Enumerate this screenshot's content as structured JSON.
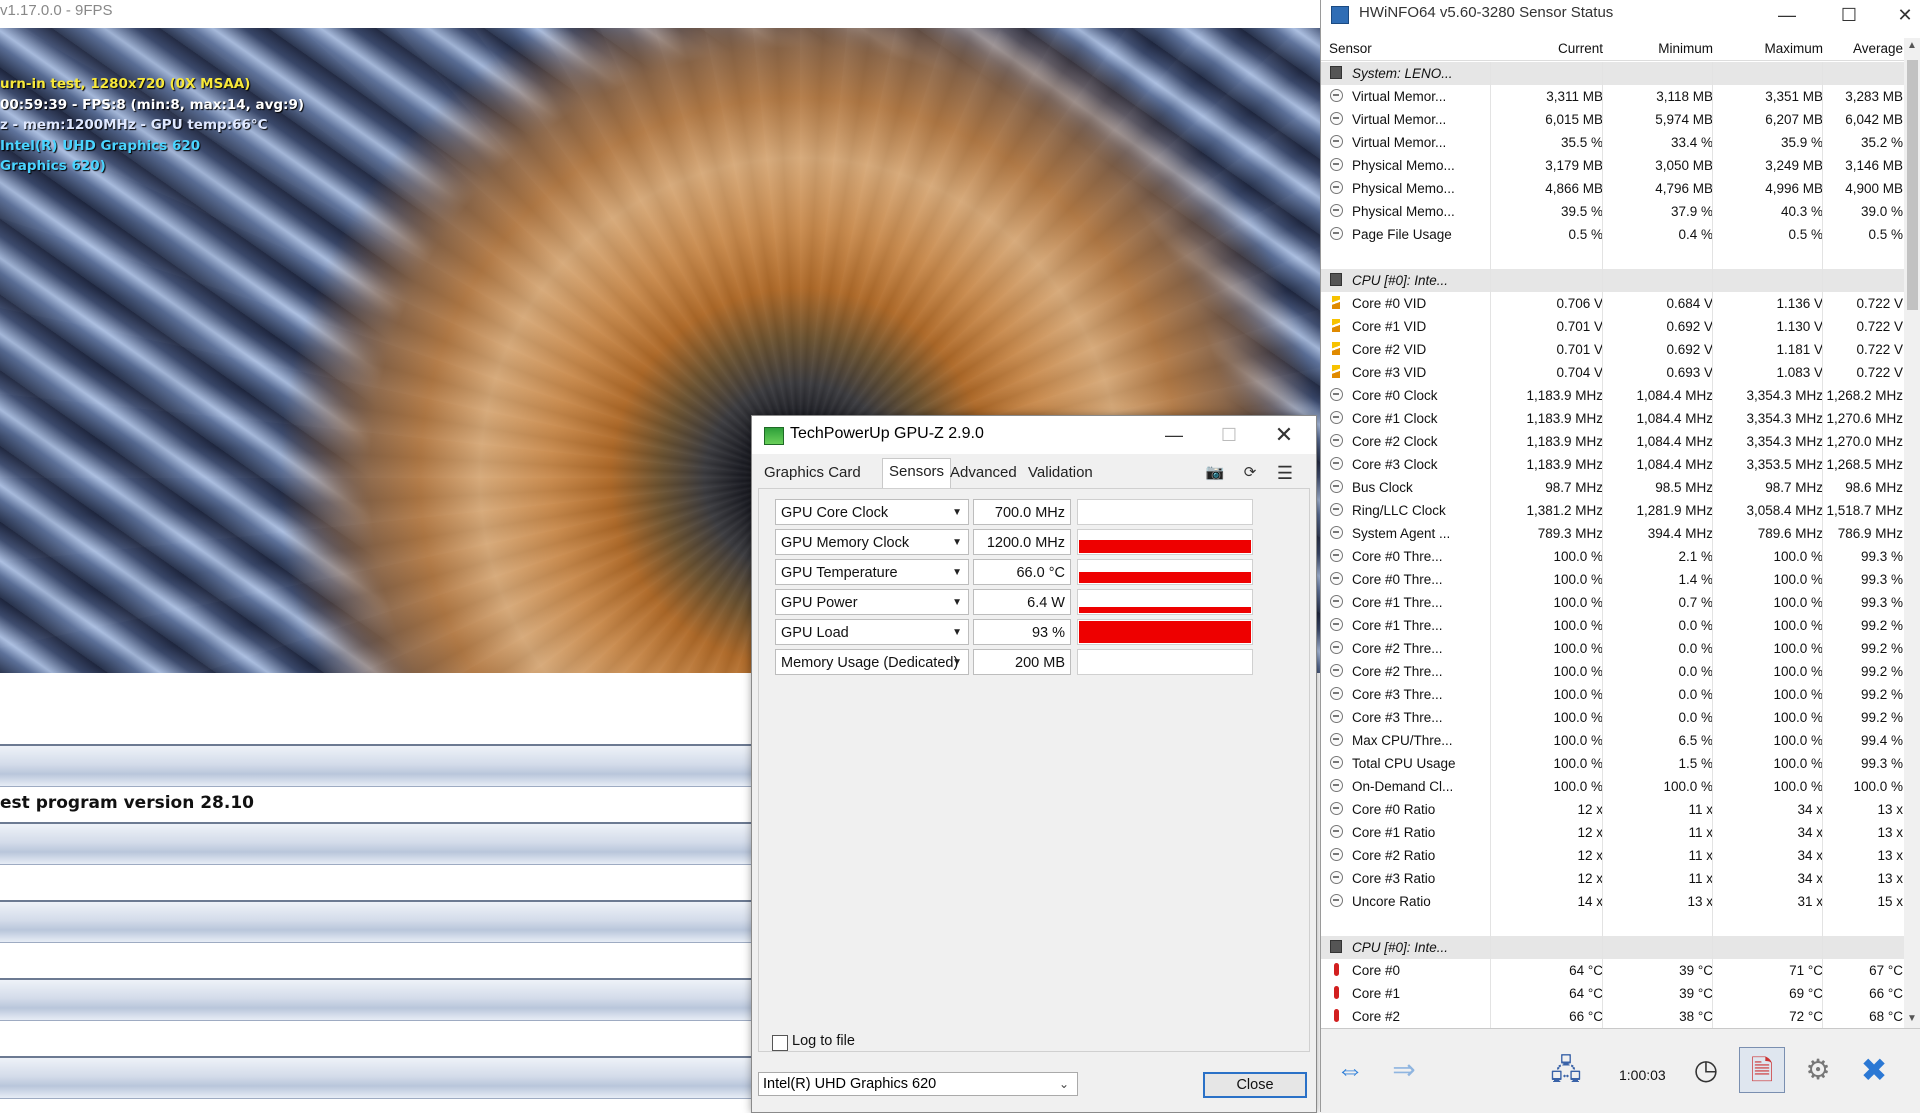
{
  "furmark": {
    "title": "v1.17.0.0 - 9FPS",
    "osd": [
      "urn-in test, 1280x720 (0X MSAA)",
      "00:59:39 - FPS:8 (min:8, max:14, avg:9)",
      "z - mem:1200MHz - GPU temp:66°C",
      "Intel(R) UHD Graphics 620",
      "Graphics 620)"
    ],
    "version_text": "est program version 28.10"
  },
  "gpuz": {
    "title": "TechPowerUp GPU-Z 2.9.0",
    "tabs": [
      "Graphics Card",
      "Sensors",
      "Advanced",
      "Validation"
    ],
    "active_tab": "Sensors",
    "sensors": [
      {
        "name": "GPU Core Clock",
        "value": "700.0 MHz",
        "graph_level": 0
      },
      {
        "name": "GPU Memory Clock",
        "value": "1200.0 MHz",
        "graph_level": 0.55
      },
      {
        "name": "GPU Temperature",
        "value": "66.0 °C",
        "graph_level": 0.45
      },
      {
        "name": "GPU Power",
        "value": "6.4 W",
        "graph_level": 0.25
      },
      {
        "name": "GPU Load",
        "value": "93 %",
        "graph_level": 0.93
      },
      {
        "name": "Memory Usage (Dedicated)",
        "value": "200 MB",
        "graph_level": 0
      }
    ],
    "log_label": "Log to file",
    "gpu_select": "Intel(R) UHD Graphics 620",
    "close_label": "Close",
    "graph_color": "#ee0000"
  },
  "hwinfo": {
    "title": "HWiNFO64 v5.60-3280 Sensor Status",
    "columns": [
      "Sensor",
      "Current",
      "Minimum",
      "Maximum",
      "Average"
    ],
    "rows": [
      {
        "type": "group",
        "icon": "chip",
        "name": "System: LENO..."
      },
      {
        "icon": "clock",
        "name": "Virtual Memor...",
        "cur": "3,311 MB",
        "min": "3,118 MB",
        "max": "3,351 MB",
        "avg": "3,283 MB"
      },
      {
        "icon": "clock",
        "name": "Virtual Memor...",
        "cur": "6,015 MB",
        "min": "5,974 MB",
        "max": "6,207 MB",
        "avg": "6,042 MB"
      },
      {
        "icon": "clock",
        "name": "Virtual Memor...",
        "cur": "35.5 %",
        "min": "33.4 %",
        "max": "35.9 %",
        "avg": "35.2 %"
      },
      {
        "icon": "clock",
        "name": "Physical Memo...",
        "cur": "3,179 MB",
        "min": "3,050 MB",
        "max": "3,249 MB",
        "avg": "3,146 MB"
      },
      {
        "icon": "clock",
        "name": "Physical Memo...",
        "cur": "4,866 MB",
        "min": "4,796 MB",
        "max": "4,996 MB",
        "avg": "4,900 MB"
      },
      {
        "icon": "clock",
        "name": "Physical Memo...",
        "cur": "39.5 %",
        "min": "37.9 %",
        "max": "40.3 %",
        "avg": "39.0 %"
      },
      {
        "icon": "clock",
        "name": "Page File Usage",
        "cur": "0.5 %",
        "min": "0.4 %",
        "max": "0.5 %",
        "avg": "0.5 %"
      },
      {
        "type": "blank"
      },
      {
        "type": "group",
        "icon": "chip",
        "name": "CPU [#0]: Inte..."
      },
      {
        "icon": "volt",
        "name": "Core #0 VID",
        "cur": "0.706 V",
        "min": "0.684 V",
        "max": "1.136 V",
        "avg": "0.722 V"
      },
      {
        "icon": "volt",
        "name": "Core #1 VID",
        "cur": "0.701 V",
        "min": "0.692 V",
        "max": "1.130 V",
        "avg": "0.722 V"
      },
      {
        "icon": "volt",
        "name": "Core #2 VID",
        "cur": "0.701 V",
        "min": "0.692 V",
        "max": "1.181 V",
        "avg": "0.722 V"
      },
      {
        "icon": "volt",
        "name": "Core #3 VID",
        "cur": "0.704 V",
        "min": "0.693 V",
        "max": "1.083 V",
        "avg": "0.722 V"
      },
      {
        "icon": "clock",
        "name": "Core #0 Clock",
        "cur": "1,183.9 MHz",
        "min": "1,084.4 MHz",
        "max": "3,354.3 MHz",
        "avg": "1,268.2 MHz"
      },
      {
        "icon": "clock",
        "name": "Core #1 Clock",
        "cur": "1,183.9 MHz",
        "min": "1,084.4 MHz",
        "max": "3,354.3 MHz",
        "avg": "1,270.6 MHz"
      },
      {
        "icon": "clock",
        "name": "Core #2 Clock",
        "cur": "1,183.9 MHz",
        "min": "1,084.4 MHz",
        "max": "3,354.3 MHz",
        "avg": "1,270.0 MHz"
      },
      {
        "icon": "clock",
        "name": "Core #3 Clock",
        "cur": "1,183.9 MHz",
        "min": "1,084.4 MHz",
        "max": "3,353.5 MHz",
        "avg": "1,268.5 MHz"
      },
      {
        "icon": "clock",
        "name": "Bus Clock",
        "cur": "98.7 MHz",
        "min": "98.5 MHz",
        "max": "98.7 MHz",
        "avg": "98.6 MHz"
      },
      {
        "icon": "clock",
        "name": "Ring/LLC Clock",
        "cur": "1,381.2 MHz",
        "min": "1,281.9 MHz",
        "max": "3,058.4 MHz",
        "avg": "1,518.7 MHz"
      },
      {
        "icon": "clock",
        "name": "System Agent ...",
        "cur": "789.3 MHz",
        "min": "394.4 MHz",
        "max": "789.6 MHz",
        "avg": "786.9 MHz"
      },
      {
        "icon": "clock",
        "name": "Core #0 Thre...",
        "cur": "100.0 %",
        "min": "2.1 %",
        "max": "100.0 %",
        "avg": "99.3 %"
      },
      {
        "icon": "clock",
        "name": "Core #0 Thre...",
        "cur": "100.0 %",
        "min": "1.4 %",
        "max": "100.0 %",
        "avg": "99.3 %"
      },
      {
        "icon": "clock",
        "name": "Core #1 Thre...",
        "cur": "100.0 %",
        "min": "0.7 %",
        "max": "100.0 %",
        "avg": "99.3 %"
      },
      {
        "icon": "clock",
        "name": "Core #1 Thre...",
        "cur": "100.0 %",
        "min": "0.0 %",
        "max": "100.0 %",
        "avg": "99.2 %"
      },
      {
        "icon": "clock",
        "name": "Core #2 Thre...",
        "cur": "100.0 %",
        "min": "0.0 %",
        "max": "100.0 %",
        "avg": "99.2 %"
      },
      {
        "icon": "clock",
        "name": "Core #2 Thre...",
        "cur": "100.0 %",
        "min": "0.0 %",
        "max": "100.0 %",
        "avg": "99.2 %"
      },
      {
        "icon": "clock",
        "name": "Core #3 Thre...",
        "cur": "100.0 %",
        "min": "0.0 %",
        "max": "100.0 %",
        "avg": "99.2 %"
      },
      {
        "icon": "clock",
        "name": "Core #3 Thre...",
        "cur": "100.0 %",
        "min": "0.0 %",
        "max": "100.0 %",
        "avg": "99.2 %"
      },
      {
        "icon": "clock",
        "name": "Max CPU/Thre...",
        "cur": "100.0 %",
        "min": "6.5 %",
        "max": "100.0 %",
        "avg": "99.4 %"
      },
      {
        "icon": "clock",
        "name": "Total CPU Usage",
        "cur": "100.0 %",
        "min": "1.5 %",
        "max": "100.0 %",
        "avg": "99.3 %"
      },
      {
        "icon": "clock",
        "name": "On-Demand Cl...",
        "cur": "100.0 %",
        "min": "100.0 %",
        "max": "100.0 %",
        "avg": "100.0 %"
      },
      {
        "icon": "clock",
        "name": "Core #0 Ratio",
        "cur": "12 x",
        "min": "11 x",
        "max": "34 x",
        "avg": "13 x"
      },
      {
        "icon": "clock",
        "name": "Core #1 Ratio",
        "cur": "12 x",
        "min": "11 x",
        "max": "34 x",
        "avg": "13 x"
      },
      {
        "icon": "clock",
        "name": "Core #2 Ratio",
        "cur": "12 x",
        "min": "11 x",
        "max": "34 x",
        "avg": "13 x"
      },
      {
        "icon": "clock",
        "name": "Core #3 Ratio",
        "cur": "12 x",
        "min": "11 x",
        "max": "34 x",
        "avg": "13 x"
      },
      {
        "icon": "clock",
        "name": "Uncore Ratio",
        "cur": "14 x",
        "min": "13 x",
        "max": "31 x",
        "avg": "15 x"
      },
      {
        "type": "blank"
      },
      {
        "type": "group",
        "icon": "chip",
        "name": "CPU [#0]: Inte..."
      },
      {
        "icon": "temp",
        "name": "Core #0",
        "cur": "64 °C",
        "min": "39 °C",
        "max": "71 °C",
        "avg": "67 °C"
      },
      {
        "icon": "temp",
        "name": "Core #1",
        "cur": "64 °C",
        "min": "39 °C",
        "max": "69 °C",
        "avg": "66 °C"
      },
      {
        "icon": "temp",
        "name": "Core #2",
        "cur": "66 °C",
        "min": "38 °C",
        "max": "72 °C",
        "avg": "68 °C"
      }
    ],
    "timer": "1:00:03"
  }
}
